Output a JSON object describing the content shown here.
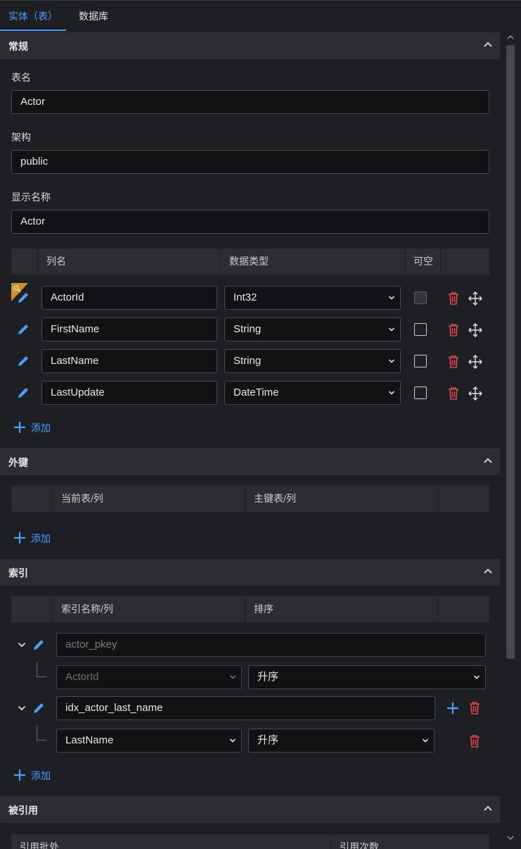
{
  "tabs": [
    {
      "label": "实体（表）",
      "active": true
    },
    {
      "label": "数据库",
      "active": false
    }
  ],
  "general": {
    "title": "常规",
    "table_name_label": "表名",
    "table_name_value": "Actor",
    "schema_label": "架构",
    "schema_value": "public",
    "display_name_label": "显示名称",
    "display_name_value": "Actor",
    "columns_headers": [
      "列名",
      "数据类型",
      "可空"
    ],
    "columns": [
      {
        "name": "ActorId",
        "type": "Int32",
        "primary_key": true,
        "nullable": false,
        "nullable_disabled": true
      },
      {
        "name": "FirstName",
        "type": "String",
        "primary_key": false,
        "nullable": false,
        "nullable_disabled": false
      },
      {
        "name": "LastName",
        "type": "String",
        "primary_key": false,
        "nullable": false,
        "nullable_disabled": false
      },
      {
        "name": "LastUpdate",
        "type": "DateTime",
        "primary_key": false,
        "nullable": false,
        "nullable_disabled": false
      }
    ],
    "add_label": "添加"
  },
  "foreign_keys": {
    "title": "外键",
    "headers": [
      "当前表/列",
      "主键表/列"
    ],
    "add_label": "添加"
  },
  "indexes": {
    "title": "索引",
    "headers": [
      "索引名称/列",
      "排序"
    ],
    "items": [
      {
        "name": "actor_pkey",
        "disabled": true,
        "column": "ActorId",
        "order": "升序"
      },
      {
        "name": "idx_actor_last_name",
        "disabled": false,
        "column": "LastName",
        "order": "升序"
      }
    ],
    "add_label": "添加"
  },
  "referenced": {
    "title": "被引用",
    "headers": [
      "引用批处",
      "引用次数"
    ]
  },
  "colors": {
    "accent": "#4a9eff",
    "danger": "#e0474c",
    "background": "#1e1f22",
    "header_bg": "#2b2d31",
    "input_bg": "#111214",
    "pk_gold": "#c9922a"
  }
}
